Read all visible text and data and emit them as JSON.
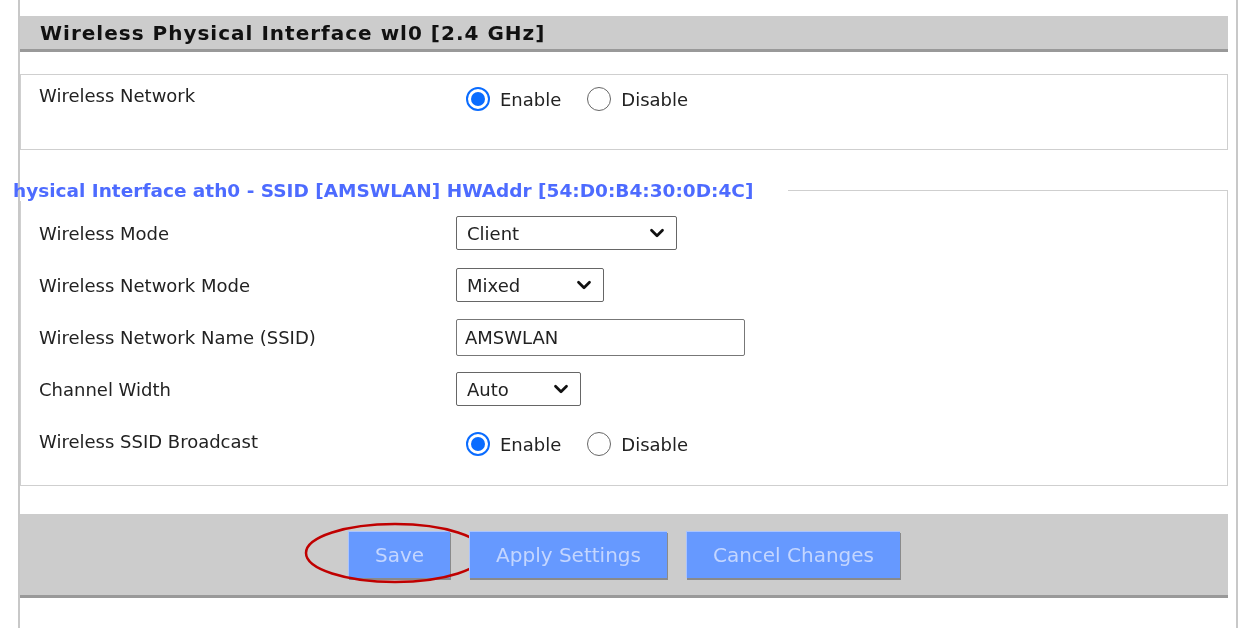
{
  "header": {
    "title": "Wireless Physical Interface wl0 [2.4 GHz]"
  },
  "wireless_network": {
    "label": "Wireless Network",
    "options": [
      {
        "label": "Enable",
        "selected": true
      },
      {
        "label": "Disable",
        "selected": false
      }
    ]
  },
  "interface": {
    "legend": "hysical Interface ath0 - SSID [AMSWLAN] HWAddr [54:D0:B4:30:0D:4C]",
    "rows": [
      {
        "kind": "select",
        "label": "Wireless Mode",
        "value": "Client"
      },
      {
        "kind": "select",
        "label": "Wireless Network Mode",
        "value": "Mixed"
      },
      {
        "kind": "text",
        "label": "Wireless Network Name (SSID)",
        "value": "AMSWLAN"
      },
      {
        "kind": "select",
        "label": "Channel Width",
        "value": "Auto"
      },
      {
        "kind": "radio",
        "label": "Wireless SSID Broadcast",
        "options": [
          {
            "label": "Enable",
            "selected": true
          },
          {
            "label": "Disable",
            "selected": false
          }
        ]
      }
    ]
  },
  "buttons": [
    {
      "label": "Save",
      "circled": true
    },
    {
      "label": "Apply Settings",
      "circled": false
    },
    {
      "label": "Cancel Changes",
      "circled": false
    }
  ]
}
